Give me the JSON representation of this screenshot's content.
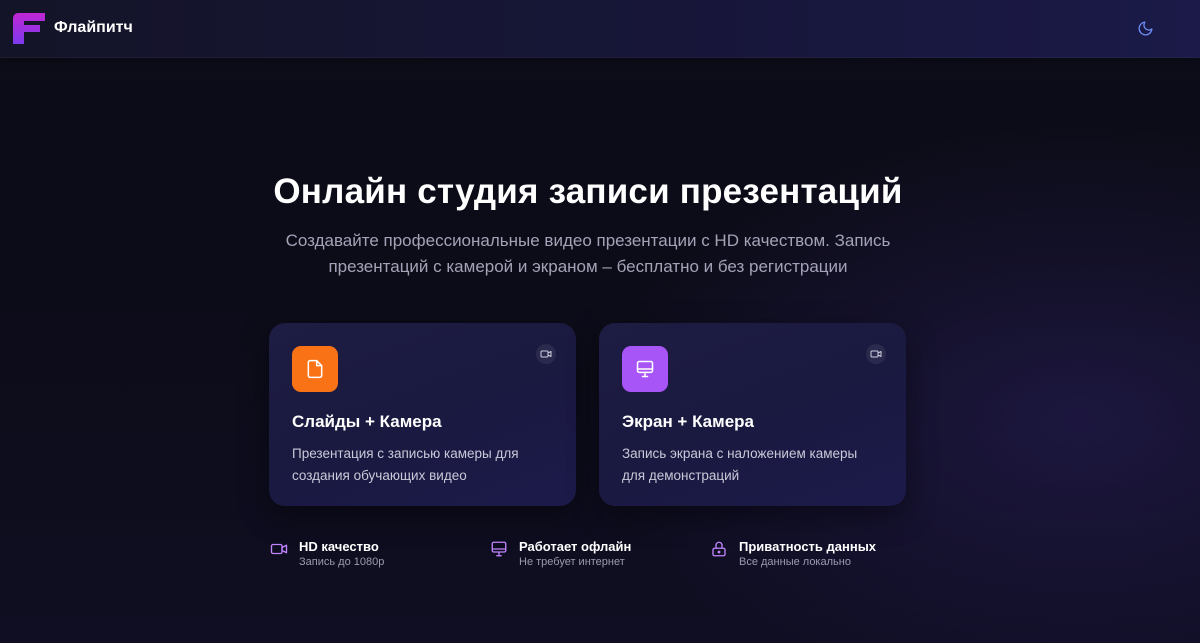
{
  "header": {
    "brand_name": "Флайпитч",
    "logo_icon": "brand-f-logo",
    "theme_toggle_icon": "moon-icon",
    "colors": {
      "logo_top": "#c026d3",
      "logo_bottom": "#7c3aed"
    }
  },
  "hero": {
    "title": "Онлайн студия записи презентаций",
    "subtitle": "Создавайте профессиональные видео презентации с HD качеством. Запись презентаций с камерой и экраном – бесплатно и без регистрации"
  },
  "cards": [
    {
      "title": "Слайды + Камера",
      "description": "Презентация с записью камеры для создания обучающих видео",
      "icon": "file-icon",
      "badge_icon": "video-camera-icon",
      "accent": "#f97316"
    },
    {
      "title": "Экран + Камера",
      "description": "Запись экрана с наложением камеры для демонстраций",
      "icon": "monitor-icon",
      "badge_icon": "video-camera-icon",
      "accent": "#a855f7"
    }
  ],
  "features": [
    {
      "title": "HD качество",
      "subtitle": "Запись до 1080p",
      "icon": "video-camera-icon"
    },
    {
      "title": "Работает офлайн",
      "subtitle": "Не требует интернет",
      "icon": "monitor-icon"
    },
    {
      "title": "Приватность данных",
      "subtitle": "Все данные локально",
      "icon": "lock-icon"
    }
  ],
  "colors": {
    "feature_icon": "#c084fc",
    "theme_icon": "#6d8df7",
    "subtitle_text": "#a3a3b8"
  }
}
